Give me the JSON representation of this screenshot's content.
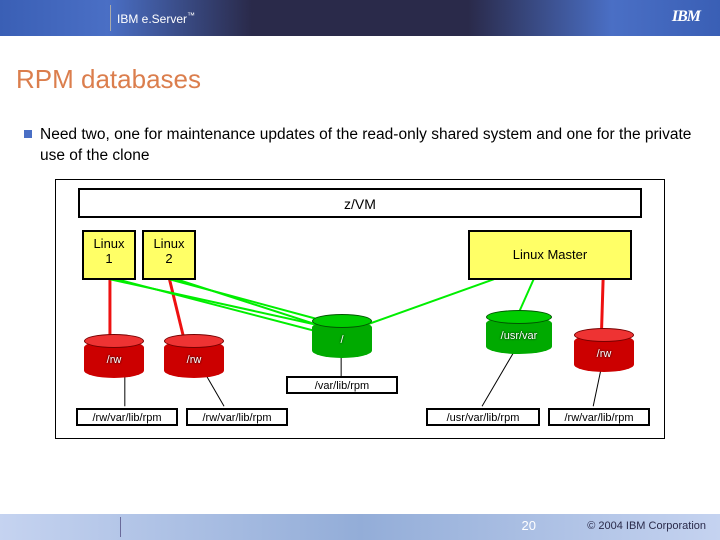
{
  "header": {
    "brand": "IBM e.Server",
    "tm": "™",
    "logo": "IBM"
  },
  "title": "RPM databases",
  "bullet1": "Need two, one for maintenance updates of the read-only shared system and one for the private use of the clone",
  "diagram": {
    "zvm": "z/VM",
    "linux1": "Linux\n1",
    "linux2": "Linux\n2",
    "master": "Linux Master",
    "disk_root": "/",
    "disk_usrvar": "/usr/var",
    "disk_rw1": "/rw",
    "disk_rw2": "/rw",
    "disk_rw3": "/rw",
    "path_varlibrpm": "/var/lib/rpm",
    "path_rw1": "/rw/var/lib/rpm",
    "path_rw2": "/rw/var/lib/rpm",
    "path_usr": "/usr/var/lib/rpm",
    "path_rw3": "/rw/var/lib/rpm"
  },
  "footer": {
    "page": "20",
    "copyright": "© 2004 IBM Corporation"
  }
}
